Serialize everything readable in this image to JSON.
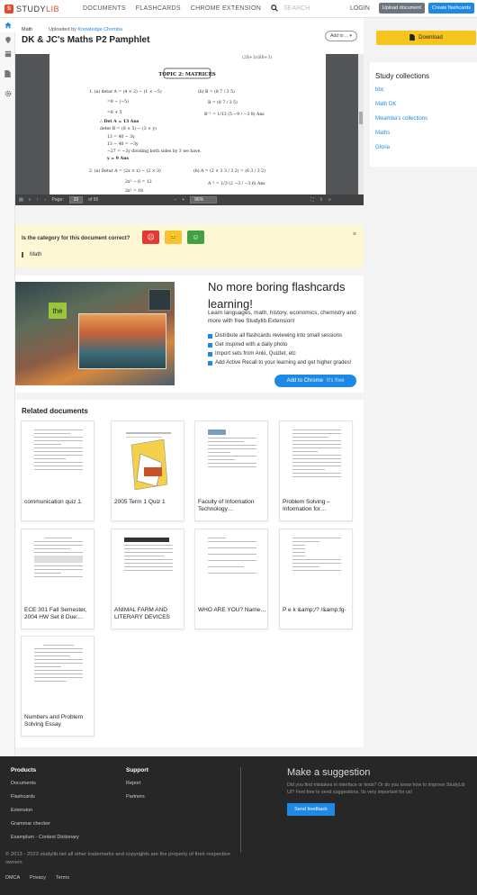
{
  "header": {
    "logo_mark": "S",
    "logo_study": "STUDY",
    "logo_lib": "LIB",
    "nav": [
      "DOCUMENTS",
      "FLASHCARDS",
      "CHROME EXTENSION"
    ],
    "search_placeholder": "SEARCH",
    "login": "LOGIN",
    "upload_label": "Upload document",
    "create_label": "Create flashcards"
  },
  "sidebar": {
    "icons": [
      "home-icon",
      "bulb-icon",
      "collection-icon",
      "document-icon",
      "gear-icon"
    ]
  },
  "document": {
    "category": "Math",
    "uploaded_by_label": "Uploaded by",
    "uploader": "Knowledge Chomba",
    "title": "DK & JC's Maths P2 Pamphlet",
    "add_to_label": "Add to ..."
  },
  "viewer": {
    "page_top_fragment": "(2B+3)(BB+3)",
    "topic_heading": "TOPIC 2: MATRICES",
    "lines_left": [
      "1.  (a)  detar A = (4 × 2) − (1 × −5)",
      "=8 − (−5)",
      "=8 + 5",
      "∴ Det A = 13 Ans",
      "deter B = (8 × 5) − (3 × y)",
      "13 = 40 − 3y",
      "13 − 40 = −3y",
      "−27 = −3y dividing both sides by 3 we have,",
      "y = 9 Ans",
      "2.  (a)  Detar A = (2x × x) − (2 × 3)",
      "2x² − 6 = 12",
      "2x² = 18"
    ],
    "lines_right": [
      "(b)  B = (8 7 / 3 5)",
      "B = (8 7 / 3 5)",
      "B⁻¹ = 1/13 (5 −9 / −3 8) Ans",
      "(b)  A = (2 × 3  3 / 3  2) = (6 3 / 3 2)",
      "A⁻¹ = 1/3 (2 −3 / −3 6) Ans"
    ],
    "page_label": "Page:",
    "page_current": "39",
    "page_total_label": "of 65",
    "zoom": "96%"
  },
  "right_panel": {
    "download_label": "Download",
    "collections_title": "Study collections",
    "collections": [
      "bbc",
      "Math DK",
      "Mwamba's collections",
      "Maths",
      "Gloria"
    ]
  },
  "category_check": {
    "question": "Is the category for this document correct?",
    "category": "Math",
    "close": "×",
    "faces": [
      "☹",
      "😐",
      "☺"
    ],
    "colors": {
      "sad": "#e53935",
      "neutral": "#f9c22e",
      "happy": "#43a047"
    }
  },
  "promo": {
    "headline": "No more boring flashcards learning!",
    "subtitle": "Learn languages, math, history, economics, chemistry and more with free Studylib Extension!",
    "bullets": [
      "Distribute all flashcards reviewing into small sessions",
      "Get inspired with a daily photo",
      "Import sets from Anki, Quizlet, etc",
      "Add Active Recall to your learning and get higher grades!"
    ],
    "image_word": "the",
    "cta_label": "Add to Chrome",
    "cta_suffix": "It's free"
  },
  "related": {
    "title": "Related documents",
    "items": [
      "communication quiz 1.",
      "2005 Term 1 Quiz 1",
      "Faculty of Information Technology…",
      "Problem Solving – Information for…",
      "ECE 301 Fall Semester, 2004 HW Set 8 Due:…",
      "ANIMAL FARM AND LITERARY DEVICES",
      "WHO ARE YOU? Name…",
      "P e k &amp;/? /&amp;fg-",
      "Numbers and Problem Solving Essay"
    ]
  },
  "footer": {
    "products_title": "Products",
    "products": [
      "Documents",
      "Flashcards",
      "Extension",
      "Grammar checker",
      "Examplum - Context Dictionary"
    ],
    "support_title": "Support",
    "support": [
      "Report",
      "Partners"
    ],
    "suggest_title": "Make a suggestion",
    "suggest_text": "Did you find mistakes in interface or texts? Or do you know how to improve StudyLib UI? Feel free to send suggestions. Its very important for us!",
    "feedback_label": "Send feedback",
    "copyright": "© 2013 - 2023 studylib.net all other trademarks and copyrights are the property of their respective owners",
    "legal": [
      "DMCA",
      "Privacy",
      "Terms"
    ]
  },
  "colors": {
    "accent": "#1e88e5",
    "download": "#f7c31d",
    "brand": "#e44b2c",
    "footer_bg": "#272727"
  }
}
